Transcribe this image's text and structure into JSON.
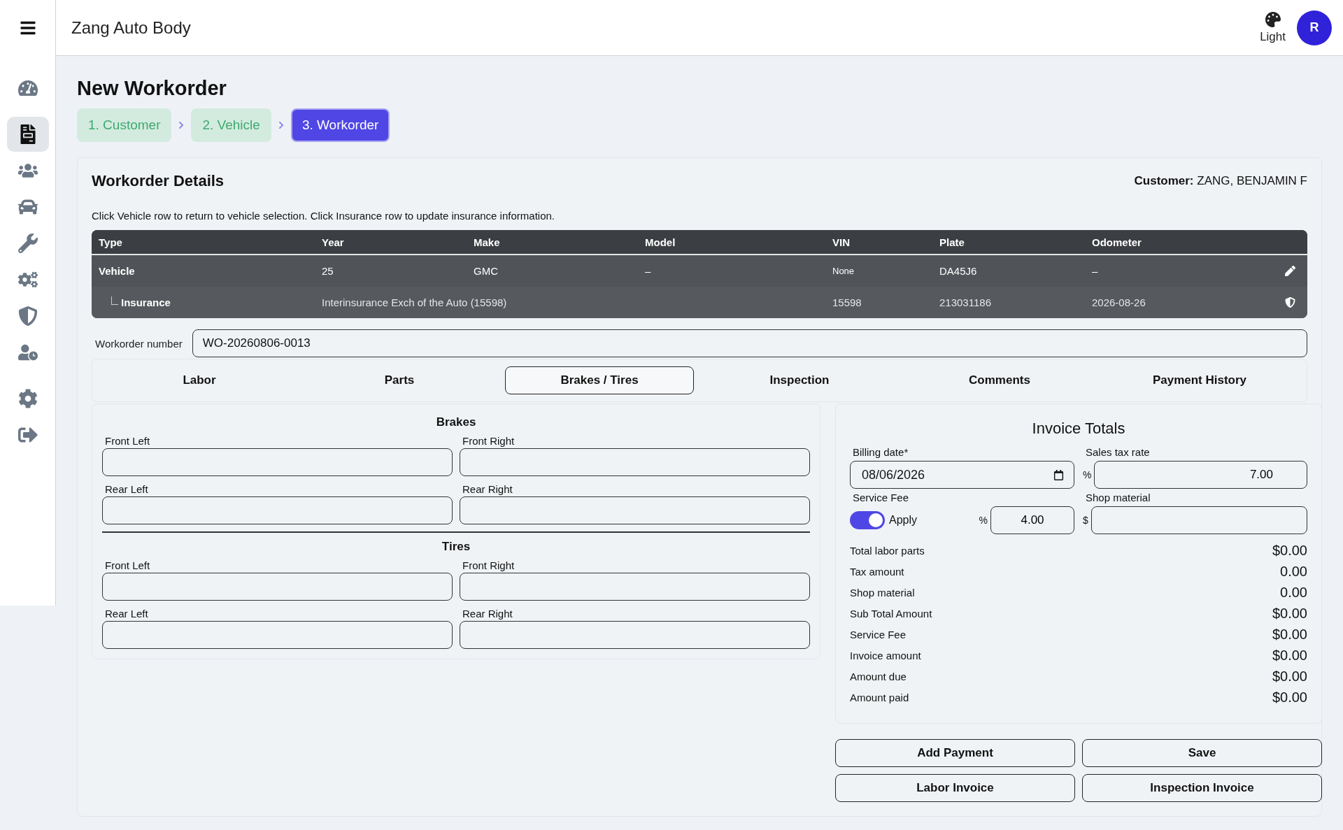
{
  "app": {
    "title": "Zang Auto Body",
    "theme_label": "Light",
    "avatar_initial": "R"
  },
  "sidebar": {
    "groups": [
      {
        "items": [
          {
            "selected": false
          }
        ]
      },
      {
        "items": [
          {
            "selected": true
          },
          {
            "selected": false
          },
          {
            "selected": false
          },
          {
            "selected": false
          },
          {
            "selected": false
          },
          {
            "selected": false
          },
          {
            "selected": false
          }
        ]
      },
      {
        "items": [
          {
            "selected": false
          },
          {
            "selected": false
          }
        ]
      }
    ]
  },
  "page": {
    "title": "New Workorder"
  },
  "steps": [
    {
      "label": "1. Customer",
      "completed": true,
      "selected": false
    },
    {
      "label": "2. Vehicle",
      "completed": true,
      "selected": false
    },
    {
      "label": "3. Workorder",
      "completed": false,
      "selected": true
    }
  ],
  "details": {
    "title": "Workorder Details",
    "customer_label": "Customer:",
    "customer_name": "ZANG, BENJAMIN F",
    "hint": "Click Vehicle row to return to vehicle selection. Click Insurance row to update insurance information.",
    "table": {
      "columns": [
        "Type",
        "Year",
        "Make",
        "Model",
        "VIN",
        "Plate",
        "Odometer"
      ],
      "rows": [
        {
          "kind": "vehicle",
          "cells": [
            "Vehicle",
            "25",
            "GMC",
            "–",
            "None",
            "DA45J6",
            "–"
          ]
        },
        {
          "kind": "insurance",
          "cells": [
            "Insurance",
            "Interinsurance Exch of the Auto (15598)",
            "",
            "",
            "15598",
            "213031186",
            "2026-08-26"
          ]
        }
      ]
    },
    "workorder_number": {
      "label": "Workorder number",
      "value": "WO-20260806-0013"
    }
  },
  "tabs": [
    {
      "label": "Labor",
      "selected": false
    },
    {
      "label": "Parts",
      "selected": false
    },
    {
      "label": "Brakes / Tires",
      "selected": true
    },
    {
      "label": "Inspection",
      "selected": false
    },
    {
      "label": "Comments",
      "selected": false
    },
    {
      "label": "Payment History",
      "selected": false
    }
  ],
  "brakes_tires": [
    {
      "title": "Brakes",
      "fields": [
        {
          "label": "Front Left"
        },
        {
          "label": "Front Right"
        },
        {
          "label": "Rear Left"
        },
        {
          "label": "Rear Right"
        }
      ]
    },
    {
      "title": "Tires",
      "fields": [
        {
          "label": "Front Left"
        },
        {
          "label": "Front Right"
        },
        {
          "label": "Rear Left"
        },
        {
          "label": "Rear Right"
        }
      ]
    }
  ],
  "invoice": {
    "title": "Invoice Totals",
    "billing_date": {
      "label": "Billing date*",
      "value": "08/06/2026"
    },
    "sales_tax": {
      "label": "Sales tax rate",
      "prefix": "%",
      "value": "7.00"
    },
    "service_fee": {
      "label": "Service Fee",
      "toggle_label": "Apply",
      "on": true,
      "prefix": "%",
      "value": "4.00"
    },
    "shop_material": {
      "label": "Shop material",
      "prefix": "$"
    },
    "totals": [
      {
        "label": "Total labor parts",
        "value": "$0.00"
      },
      {
        "label": "Tax amount",
        "value": "0.00"
      },
      {
        "label": "Shop material",
        "value": "0.00"
      },
      {
        "label": "Sub Total Amount",
        "value": "$0.00"
      },
      {
        "label": "Service Fee",
        "value": "$0.00"
      },
      {
        "label": "Invoice amount",
        "value": "$0.00"
      },
      {
        "label": "Amount due",
        "value": "$0.00"
      },
      {
        "label": "Amount paid",
        "value": "$0.00"
      }
    ],
    "buttons": [
      "Add Payment",
      "Save",
      "Labor Invoice",
      "Inspection Invoice"
    ]
  }
}
